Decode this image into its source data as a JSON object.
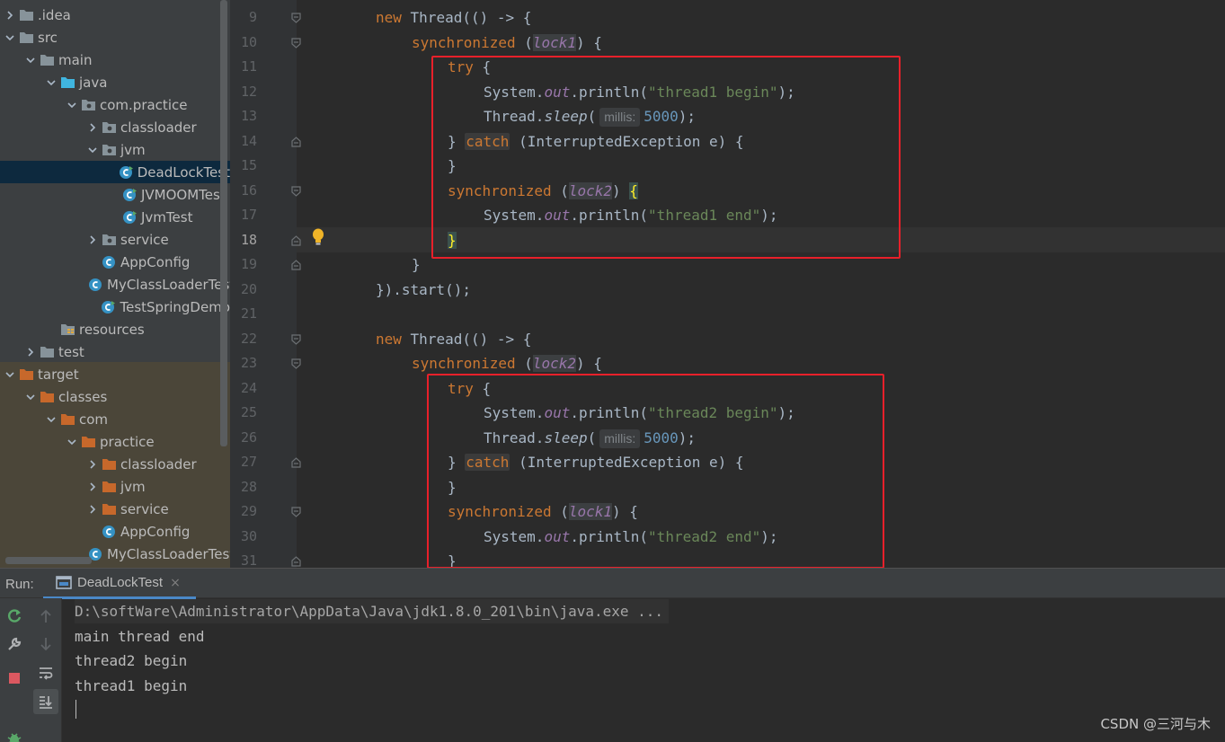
{
  "project_tree": [
    {
      "label": ".idea",
      "icon": "folder-gray",
      "expanded": false,
      "depth": 0
    },
    {
      "label": "src",
      "icon": "folder-gray",
      "expanded": true,
      "depth": 0
    },
    {
      "label": "main",
      "icon": "folder-gray",
      "expanded": true,
      "depth": 1
    },
    {
      "label": "java",
      "icon": "folder-blue",
      "expanded": true,
      "depth": 2
    },
    {
      "label": "com.practice",
      "icon": "package",
      "expanded": true,
      "depth": 3
    },
    {
      "label": "classloader",
      "icon": "package",
      "expanded": false,
      "depth": 4
    },
    {
      "label": "jvm",
      "icon": "package",
      "expanded": true,
      "depth": 4
    },
    {
      "label": "DeadLockTest",
      "icon": "class-runnable",
      "expanded": null,
      "depth": 5,
      "selected": true
    },
    {
      "label": "JVMOOMTest",
      "icon": "class-runnable",
      "expanded": null,
      "depth": 5
    },
    {
      "label": "JvmTest",
      "icon": "class-runnable",
      "expanded": null,
      "depth": 5
    },
    {
      "label": "service",
      "icon": "package",
      "expanded": false,
      "depth": 4
    },
    {
      "label": "AppConfig",
      "icon": "class",
      "expanded": null,
      "depth": 4
    },
    {
      "label": "MyClassLoaderTest",
      "icon": "class",
      "expanded": null,
      "depth": 4
    },
    {
      "label": "TestSpringDemo",
      "icon": "class-runnable",
      "expanded": null,
      "depth": 4
    },
    {
      "label": "resources",
      "icon": "folder-resources",
      "expanded": null,
      "depth": 2
    },
    {
      "label": "test",
      "icon": "folder-gray",
      "expanded": false,
      "depth": 1
    },
    {
      "label": "target",
      "icon": "folder-orange",
      "expanded": true,
      "depth": 0
    },
    {
      "label": "classes",
      "icon": "folder-orange",
      "expanded": true,
      "depth": 1
    },
    {
      "label": "com",
      "icon": "folder-orange",
      "expanded": true,
      "depth": 2
    },
    {
      "label": "practice",
      "icon": "folder-orange",
      "expanded": true,
      "depth": 3
    },
    {
      "label": "classloader",
      "icon": "folder-orange",
      "expanded": false,
      "depth": 4
    },
    {
      "label": "jvm",
      "icon": "folder-orange",
      "expanded": false,
      "depth": 4
    },
    {
      "label": "service",
      "icon": "folder-orange",
      "expanded": false,
      "depth": 4
    },
    {
      "label": "AppConfig",
      "icon": "class",
      "expanded": null,
      "depth": 4
    },
    {
      "label": "MyClassLoaderTest",
      "icon": "class",
      "expanded": null,
      "depth": 4
    }
  ],
  "editor": {
    "line_numbers": [
      "9",
      "10",
      "11",
      "12",
      "13",
      "14",
      "15",
      "16",
      "17",
      "18",
      "19",
      "20",
      "21",
      "22",
      "23",
      "24",
      "25",
      "26",
      "27",
      "28",
      "29",
      "30",
      "31"
    ],
    "current_line": "18",
    "lines": [
      [
        [
          "",
          "new"
        ],
        [
          " Thread(() -> {",
          ""
        ]
      ],
      [
        [
          "",
          "synchronized"
        ],
        [
          " (",
          ""
        ],
        [
          "lock1",
          "lock"
        ],
        [
          ") {",
          ""
        ]
      ],
      [
        [
          "",
          "try"
        ],
        [
          " {",
          ""
        ]
      ],
      [
        [
          "System.",
          ""
        ],
        [
          "out",
          "fld"
        ],
        [
          ".println(",
          ""
        ],
        [
          "\"thread1 begin\"",
          "str"
        ],
        [
          ");",
          ""
        ]
      ],
      [
        [
          "Thread.",
          ""
        ],
        [
          "sleep",
          "ital"
        ],
        [
          "(",
          ""
        ],
        [
          "millis:",
          "hint"
        ],
        [
          "5000",
          "num"
        ],
        [
          ");",
          ""
        ]
      ],
      [
        [
          "} ",
          ""
        ],
        [
          "catch",
          "kwhl"
        ],
        [
          " (InterruptedException e) {",
          ""
        ]
      ],
      [
        [
          "}",
          ""
        ]
      ],
      [
        [
          "",
          "synchronized"
        ],
        [
          " (",
          ""
        ],
        [
          "lock2",
          "lock"
        ],
        [
          ") ",
          ""
        ],
        [
          "{",
          "brace"
        ]
      ],
      [
        [
          "System.",
          ""
        ],
        [
          "out",
          "fld"
        ],
        [
          ".println(",
          ""
        ],
        [
          "\"thread1 end\"",
          "str"
        ],
        [
          ");",
          ""
        ]
      ],
      [
        [
          "}",
          "brace"
        ]
      ],
      [
        [
          "}",
          ""
        ]
      ],
      [
        [
          "}).start();",
          ""
        ]
      ],
      [],
      [
        [
          "",
          "new"
        ],
        [
          " Thread(() -> {",
          ""
        ]
      ],
      [
        [
          "",
          "synchronized"
        ],
        [
          " (",
          ""
        ],
        [
          "lock2",
          "lock"
        ],
        [
          ") {",
          ""
        ]
      ],
      [
        [
          "",
          "try"
        ],
        [
          " {",
          ""
        ]
      ],
      [
        [
          "System.",
          ""
        ],
        [
          "out",
          "fld"
        ],
        [
          ".println(",
          ""
        ],
        [
          "\"thread2 begin\"",
          "str"
        ],
        [
          ");",
          ""
        ]
      ],
      [
        [
          "Thread.",
          ""
        ],
        [
          "sleep",
          "ital"
        ],
        [
          "(",
          ""
        ],
        [
          "millis:",
          "hint"
        ],
        [
          "5000",
          "num"
        ],
        [
          ");",
          ""
        ]
      ],
      [
        [
          "} ",
          ""
        ],
        [
          "catch",
          "kwhl"
        ],
        [
          " (InterruptedException e) {",
          ""
        ]
      ],
      [
        [
          "}",
          ""
        ]
      ],
      [
        [
          "",
          "synchronized"
        ],
        [
          " (",
          ""
        ],
        [
          "lock1",
          "lock"
        ],
        [
          ") {",
          ""
        ]
      ],
      [
        [
          "System.",
          ""
        ],
        [
          "out",
          "fld"
        ],
        [
          ".println(",
          ""
        ],
        [
          "\"thread2 end\"",
          "str"
        ],
        [
          ");",
          ""
        ]
      ],
      [
        [
          "}",
          ""
        ]
      ]
    ],
    "indent": [
      2,
      3,
      4,
      5,
      5,
      4,
      4,
      4,
      5,
      4,
      3,
      2,
      0,
      2,
      3,
      4,
      5,
      5,
      4,
      4,
      4,
      5,
      4
    ]
  },
  "run_panel": {
    "label": "Run:",
    "tab_label": "DeadLockTest",
    "tab_close": "×",
    "console": [
      "D:\\softWare\\Administrator\\AppData\\Java\\jdk1.8.0_201\\bin\\java.exe ...",
      "main thread end",
      "thread2 begin",
      "thread1 begin"
    ]
  },
  "watermark": "CSDN @三河与木",
  "colors": {
    "keyword": "#cc7832",
    "string": "#6a8759",
    "number": "#6897bb",
    "field": "#9876aa",
    "annotation_box": "#e8202a"
  }
}
